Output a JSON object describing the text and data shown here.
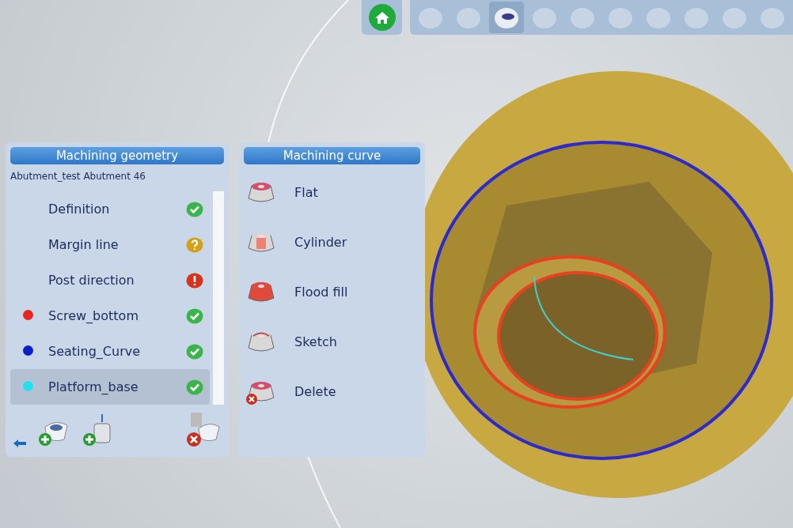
{
  "toolbar": {
    "tools": [
      {
        "selected": false
      },
      {
        "selected": false
      },
      {
        "selected": true
      },
      {
        "selected": false
      },
      {
        "selected": false
      },
      {
        "selected": false
      },
      {
        "selected": false
      },
      {
        "selected": false
      },
      {
        "selected": false
      },
      {
        "selected": false
      }
    ]
  },
  "geometry_panel": {
    "title": "Machining geometry",
    "subtitle": "Abutment_test Abutment 46",
    "items": [
      {
        "label": "Definition",
        "kind": "ok",
        "selected": false
      },
      {
        "label": "Margin line",
        "kind": "unknown",
        "selected": false
      },
      {
        "label": "Post direction",
        "kind": "error",
        "selected": false
      },
      {
        "label": "Screw_bottom",
        "kind": "ok",
        "color": "#e8251e",
        "selected": false
      },
      {
        "label": "Seating_Curve",
        "kind": "ok",
        "color": "#0a1fc8",
        "selected": false
      },
      {
        "label": "Platform_base",
        "kind": "ok",
        "color": "#22e0f0",
        "selected": true
      }
    ]
  },
  "curve_panel": {
    "title": "Machining curve",
    "items": [
      {
        "label": "Flat",
        "kind": "flat"
      },
      {
        "label": "Cylinder",
        "kind": "cylinder"
      },
      {
        "label": "Flood fill",
        "kind": "flood"
      },
      {
        "label": "Sketch",
        "kind": "sketch"
      },
      {
        "label": "Delete",
        "kind": "delete"
      }
    ]
  }
}
